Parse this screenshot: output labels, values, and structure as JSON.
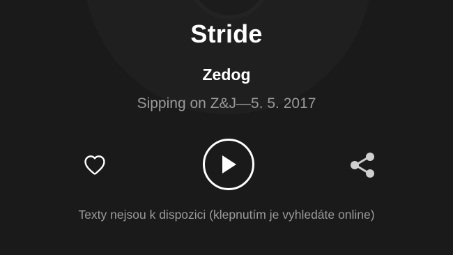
{
  "track": {
    "title": "Stride",
    "artist": "Zedog",
    "album_line": "Sipping on Z&J—5. 5. 2017"
  },
  "controls": {
    "favorite_icon": "heart-outline-icon",
    "play_icon": "play-icon",
    "share_icon": "share-icon"
  },
  "lyrics": {
    "message": "Texty nejsou k dispozici (klepnutím je vyhledáte online)"
  },
  "colors": {
    "background": "#1a1a1a",
    "primary_text": "#ffffff",
    "secondary_text": "#9a9a9a",
    "icon": "#ffffff",
    "share_icon": "#cfcfcf"
  }
}
